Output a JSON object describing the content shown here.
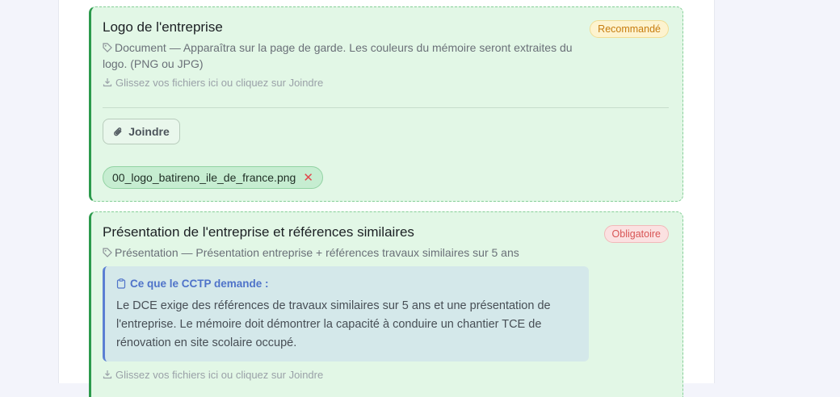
{
  "cards": [
    {
      "title": "Logo de l'entreprise",
      "badge": "Recommandé",
      "description": "Document — Apparaîtra sur la page de garde. Les couleurs du mémoire seront extraites du logo. (PNG ou JPG)",
      "drop_hint": "Glissez vos fichiers ici ou cliquez sur Joindre",
      "attach_label": "Joindre",
      "files": [
        "00_logo_batireno_ile_de_france.png"
      ],
      "remove_symbol": "✕"
    },
    {
      "title": "Présentation de l'entreprise et références similaires",
      "badge": "Obligatoire",
      "description": "Présentation — Présentation entreprise + références travaux similaires sur 5 ans",
      "cctp_heading": "Ce que le CCTP demande :",
      "cctp_text": "Le DCE exige des références de travaux similaires sur 5 ans et une présentation de l'entreprise. Le mémoire doit démontrer la capacité à conduire un chantier TCE de rénovation en site scolaire occupé.",
      "drop_hint": "Glissez vos fichiers ici ou cliquez sur Joindre"
    }
  ],
  "icons": {
    "tag": "tag-icon",
    "download": "download-icon",
    "paperclip": "paperclip-icon",
    "clipboard": "clipboard-icon",
    "remove": "close-icon"
  },
  "colors": {
    "card_bg": "#e2f7e6",
    "card_accent": "#2c9a4c",
    "recommended": "#c77c0e",
    "required": "#d85555",
    "cctp_accent": "#5b7fd3"
  }
}
